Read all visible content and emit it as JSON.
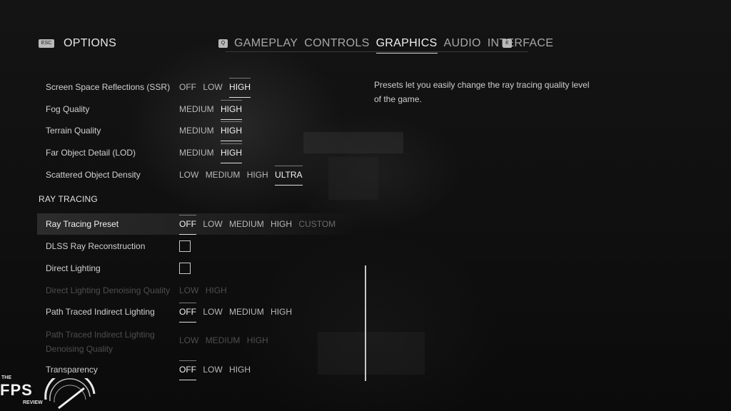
{
  "header": {
    "esc_key": "ESC",
    "title": "OPTIONS",
    "prev_tab_key": "Q",
    "next_tab_key": "E",
    "tabs": [
      "GAMEPLAY",
      "CONTROLS",
      "GRAPHICS",
      "AUDIO",
      "INTERFACE"
    ],
    "active_tab": "GRAPHICS"
  },
  "settings": [
    {
      "label": "Screen Space Reflections (SSR)",
      "options": [
        "OFF",
        "LOW",
        "HIGH"
      ],
      "selected": "HIGH"
    },
    {
      "label": "Fog Quality",
      "options": [
        "MEDIUM",
        "HIGH"
      ],
      "selected": "HIGH"
    },
    {
      "label": "Terrain Quality",
      "options": [
        "MEDIUM",
        "HIGH"
      ],
      "selected": "HIGH"
    },
    {
      "label": "Far Object Detail (LOD)",
      "options": [
        "MEDIUM",
        "HIGH"
      ],
      "selected": "HIGH"
    },
    {
      "label": "Scattered Object Density",
      "options": [
        "LOW",
        "MEDIUM",
        "HIGH",
        "ULTRA"
      ],
      "selected": "ULTRA"
    }
  ],
  "ray_tracing": {
    "section_title": "RAY TRACING",
    "preset": {
      "label": "Ray Tracing Preset",
      "options": [
        "OFF",
        "LOW",
        "MEDIUM",
        "HIGH"
      ],
      "extra_option": "CUSTOM",
      "selected": "OFF"
    },
    "dlss_ray_reconstruction": {
      "label": "DLSS Ray Reconstruction",
      "checked": false
    },
    "direct_lighting": {
      "label": "Direct Lighting",
      "checked": false
    },
    "direct_lighting_denoising": {
      "label": "Direct Lighting Denoising Quality",
      "options": [
        "LOW",
        "HIGH"
      ],
      "disabled": true
    },
    "path_traced_indirect": {
      "label": "Path Traced Indirect Lighting",
      "options": [
        "OFF",
        "LOW",
        "MEDIUM",
        "HIGH"
      ],
      "selected": "OFF"
    },
    "path_traced_denoising": {
      "label_line1": "Path Traced Indirect Lighting",
      "label_line2": "Denoising Quality",
      "options": [
        "LOW",
        "MEDIUM",
        "HIGH"
      ],
      "disabled": true
    },
    "transparency": {
      "label": "Transparency",
      "options": [
        "OFF",
        "LOW",
        "HIGH"
      ],
      "selected": "OFF"
    }
  },
  "description": "Presets let you easily change the ray tracing quality level of the game.",
  "watermark": {
    "the": "THE",
    "fps": "FPS",
    "review": "REVIEW"
  },
  "colors": {
    "background": "#101010",
    "text": "#d6d6d6",
    "active": "#f0f0f0",
    "disabled": "#4e4e4e"
  }
}
